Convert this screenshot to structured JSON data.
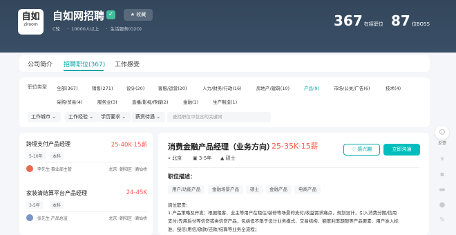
{
  "company": {
    "logo_main": "自如",
    "logo_sub": "ziroom",
    "name": "自如网招聘",
    "verified_icon": "shield-check-icon",
    "follow_label": "收藏",
    "follow_icon": "star-icon",
    "meta": [
      "C轮",
      "10000人以上",
      "生活服务(O2O)"
    ],
    "stats": [
      {
        "number": "367",
        "label": "在招职位"
      },
      {
        "number": "87",
        "label": "位BOSS"
      }
    ]
  },
  "tabs": [
    {
      "label": "公司简介"
    },
    {
      "label": "招聘职位(367)"
    },
    {
      "label": "工作感受"
    }
  ],
  "filters": {
    "label": "职位类型",
    "row1": [
      "全部(367)",
      "销售(271)",
      "设计(20)",
      "客服/运营(20)",
      "人力/财务/行政(16)",
      "房地产/建筑(10)",
      "产品(9)",
      "市场/公关/广告(6)",
      "技术(4)"
    ],
    "row2": [
      "采购/贸易(4)",
      "服务业(3)",
      "直播/影视/传媒(2)",
      "金融(1)",
      "生产制造(1)"
    ],
    "dropdowns": [
      "工作城市",
      "工作经验",
      "学历要求",
      "薪资待遇"
    ],
    "search_placeholder": "查找职位中包含的关键词"
  },
  "jobs": [
    {
      "title": "跨境支付产品经理",
      "salary": "25-40K·15薪",
      "tags": [
        "5-10年",
        "本科"
      ],
      "boss": "李先生·事业部主管",
      "location": "北京 ·朝阳区 ·酒仙桥"
    },
    {
      "title": "家装清结算平台产品经理",
      "salary": "24-45K",
      "tags": [
        "3-5年",
        "本科"
      ],
      "boss": "张先生·产品总监",
      "location": "北京 ·朝阳区 ·酒仙桥"
    }
  ],
  "detail": {
    "title": "消费金融产品经理（业务方向）",
    "salary": "25-35K·15薪",
    "info": [
      "北京",
      "3-5年",
      "硕士"
    ],
    "interest_label": "感兴趣",
    "chat_label": "立即沟通",
    "section": "职位描述：",
    "tags": [
      "用户/功能产品",
      "金融场景产品",
      "硕士",
      "金融产品",
      "电商产品"
    ],
    "desc": [
      "岗位职责：",
      "1.产品策略及开发：根据租客、业主等用户在租住/装修等场景的支付/收益需求痛点，规划设计，引入消费分期/信用",
      "支付/先用后付等信贷或类信贷产品，包括但不限于设计业务模式、交易结构、额度利率期限等产品要素、用户准入标",
      "准、授信/用信/放款/还款/结算等业务全流程；"
    ]
  },
  "sidebar": {
    "feedback_label": "反馈"
  },
  "colors": {
    "accent": "#00a6a7",
    "salary": "#fe574a",
    "hero": "#33465c"
  }
}
